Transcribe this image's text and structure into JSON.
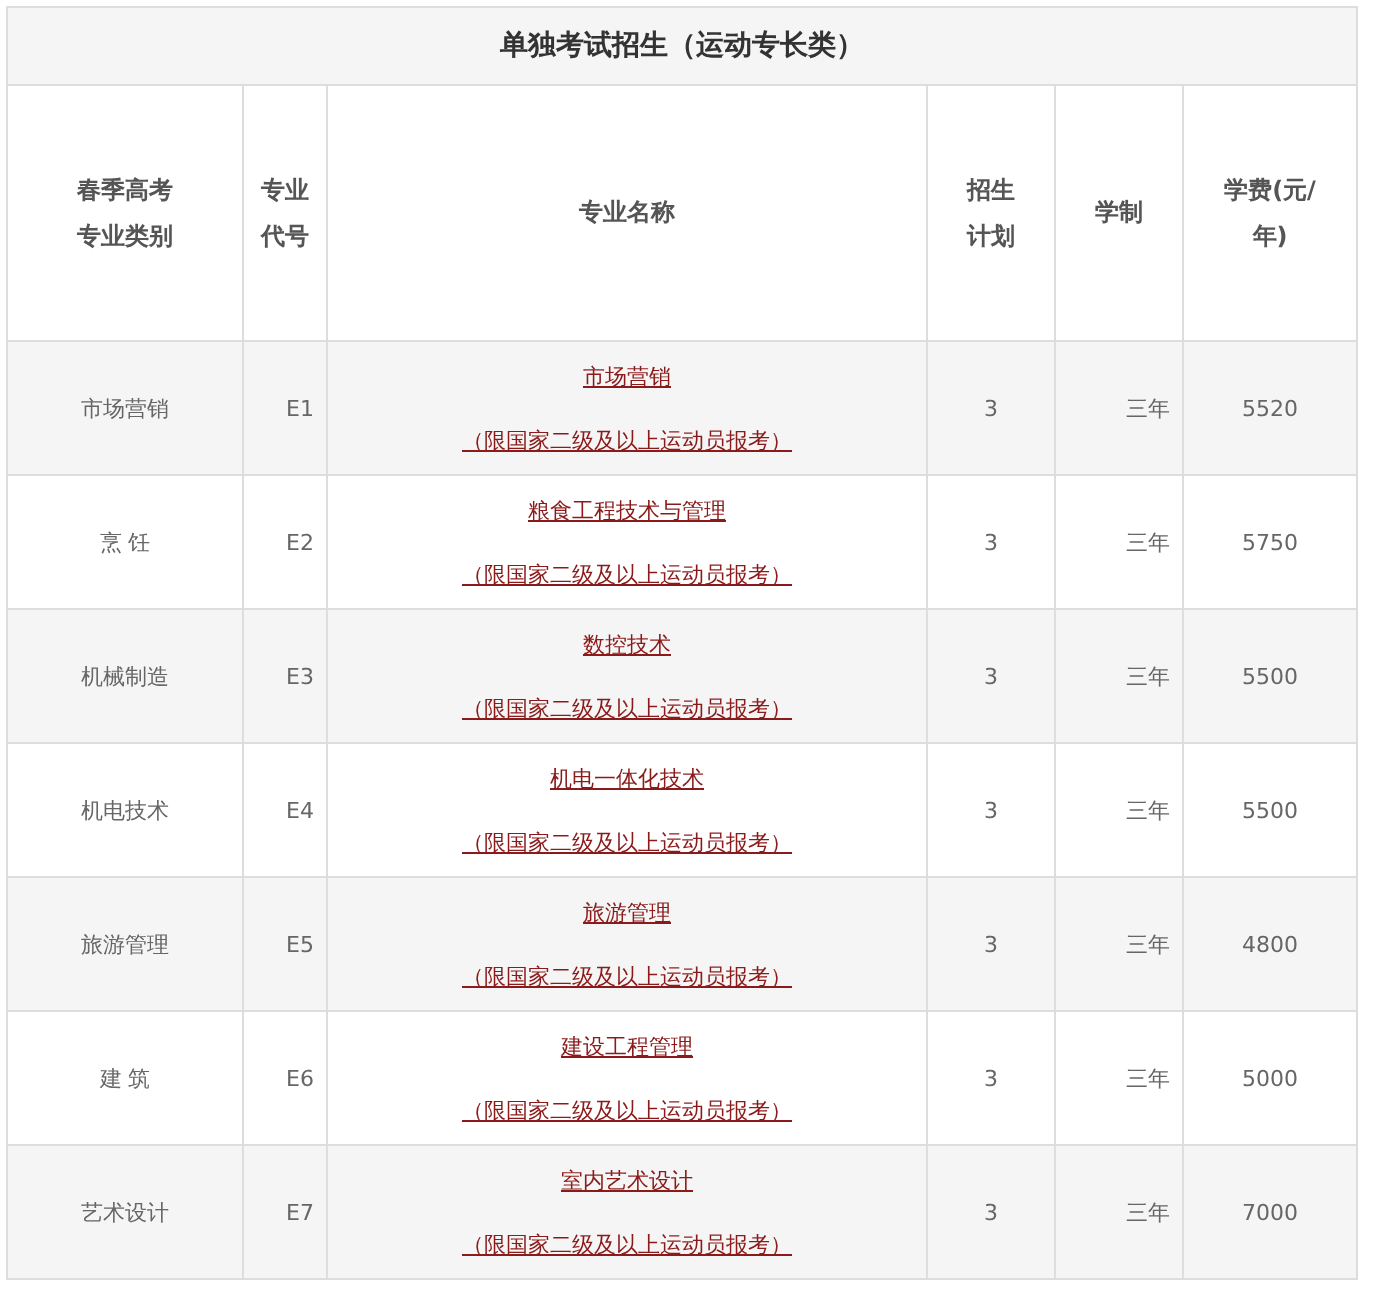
{
  "table": {
    "title": "单独考试招生（运动专长类）",
    "columns": [
      "春季高考专业类别",
      "专业代号",
      "专业名称",
      "招生计划",
      "学制",
      "学费(元/年)"
    ],
    "rows": [
      {
        "category": "市场营销",
        "code": "E1",
        "major": "市场营销",
        "note": "（限国家二级及以上运动员报考）",
        "plan": "3",
        "duration": "三年",
        "fee": "5520"
      },
      {
        "category": "烹 饪",
        "code": "E2",
        "major": "粮食工程技术与管理",
        "note": "（限国家二级及以上运动员报考）",
        "plan": "3",
        "duration": "三年",
        "fee": "5750"
      },
      {
        "category": "机械制造",
        "code": "E3",
        "major": "数控技术",
        "note": "（限国家二级及以上运动员报考）",
        "plan": "3",
        "duration": "三年",
        "fee": "5500"
      },
      {
        "category": "机电技术",
        "code": "E4",
        "major": "机电一体化技术",
        "note": "（限国家二级及以上运动员报考）",
        "plan": "3",
        "duration": "三年",
        "fee": "5500"
      },
      {
        "category": "旅游管理",
        "code": "E5",
        "major": "旅游管理",
        "note": "（限国家二级及以上运动员报考）",
        "plan": "3",
        "duration": "三年",
        "fee": "4800"
      },
      {
        "category": "建 筑",
        "code": "E6",
        "major": "建设工程管理",
        "note": "（限国家二级及以上运动员报考）",
        "plan": "3",
        "duration": "三年",
        "fee": "5000"
      },
      {
        "category": "艺术设计",
        "code": "E7",
        "major": "室内艺术设计",
        "note": "（限国家二级及以上运动员报考）",
        "plan": "3",
        "duration": "三年",
        "fee": "7000"
      }
    ]
  }
}
